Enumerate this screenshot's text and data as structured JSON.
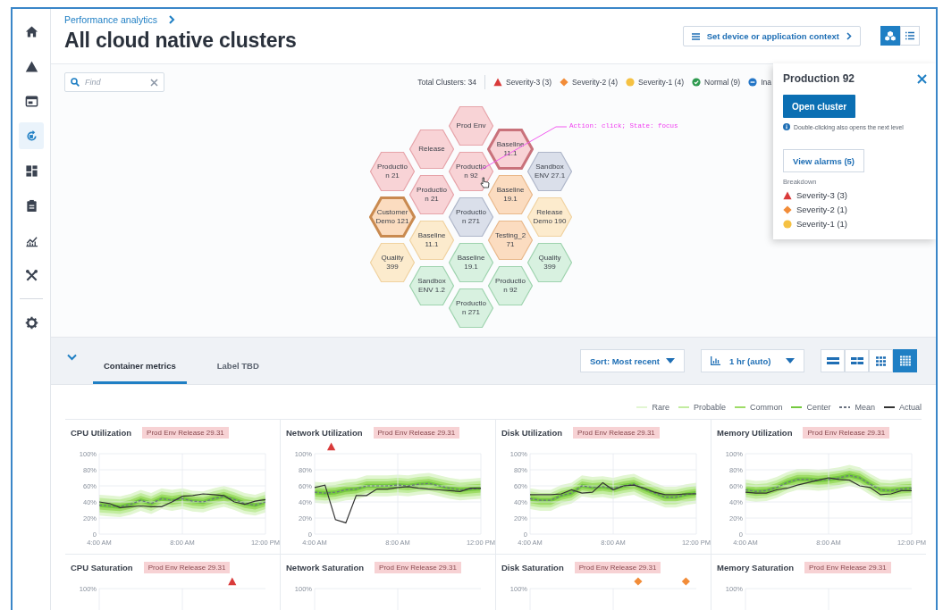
{
  "sidebar": {
    "items": [
      {
        "kind": "home",
        "selected": false
      },
      {
        "kind": "warning",
        "selected": false
      },
      {
        "kind": "window",
        "selected": false
      },
      {
        "kind": "cycle",
        "selected": true
      },
      {
        "kind": "dashboard",
        "selected": false
      },
      {
        "kind": "clipboard",
        "selected": false
      },
      {
        "kind": "chart",
        "selected": false
      },
      {
        "kind": "tools",
        "selected": false
      },
      {
        "kind": "settings",
        "selected": false
      }
    ]
  },
  "header": {
    "breadcrumb": "Performance analytics",
    "title": "All cloud native clusters",
    "context_button": "Set device or application context",
    "views": [
      {
        "kind": "hex",
        "selected": true
      },
      {
        "kind": "list",
        "selected": false
      }
    ]
  },
  "map": {
    "find": {
      "placeholder": "Find"
    },
    "total": "Total Clusters: 34",
    "legend": [
      {
        "kind": "sev3",
        "label": "Severity-3 (3)"
      },
      {
        "kind": "sev2",
        "label": "Severity-2 (4)"
      },
      {
        "kind": "sev1",
        "label": "Severity-1 (4)"
      },
      {
        "kind": "normal",
        "label": "Normal (9)"
      },
      {
        "kind": "inactive",
        "label": "Ina"
      }
    ],
    "annotation": "Action: click; State: focus",
    "columns": [
      [
        {
          "lines": [
            "Productio",
            "n 21"
          ],
          "kind": "sev3",
          "emphasized": false,
          "pointer": false
        },
        {
          "lines": [
            "Customer",
            "Demo 121"
          ],
          "kind": "sev2",
          "emphasized": true,
          "pointer": false
        },
        {
          "lines": [
            "Quality",
            "399"
          ],
          "kind": "sev1",
          "emphasized": false,
          "pointer": false
        }
      ],
      [
        {
          "lines": [
            "Release"
          ],
          "kind": "sev3",
          "emphasized": false,
          "pointer": false
        },
        {
          "lines": [
            "Productio",
            "n 21"
          ],
          "kind": "sev3",
          "emphasized": false,
          "pointer": false
        },
        {
          "lines": [
            "Baseline",
            "11.1"
          ],
          "kind": "sev1",
          "emphasized": false,
          "pointer": false
        },
        {
          "lines": [
            "Sandbox",
            "ENV 1.2"
          ],
          "kind": "normal",
          "emphasized": false,
          "pointer": false
        }
      ],
      [
        {
          "lines": [
            "Prod Env"
          ],
          "kind": "sev3",
          "emphasized": false,
          "pointer": false
        },
        {
          "lines": [
            "Productio",
            "n 92"
          ],
          "kind": "sev3",
          "emphasized": false,
          "pointer": true
        },
        {
          "lines": [
            "Productio",
            "n 271"
          ],
          "kind": "inactive",
          "emphasized": false,
          "pointer": false
        },
        {
          "lines": [
            "Baseline",
            "19.1"
          ],
          "kind": "normal",
          "emphasized": false,
          "pointer": false
        },
        {
          "lines": [
            "Productio",
            "n 271"
          ],
          "kind": "normal",
          "emphasized": false,
          "pointer": false
        }
      ],
      [
        {
          "lines": [
            "Baseline",
            "11.1"
          ],
          "kind": "sev3",
          "emphasized": true,
          "pointer": false
        },
        {
          "lines": [
            "Baseline",
            "19.1"
          ],
          "kind": "sev2",
          "emphasized": false,
          "pointer": false
        },
        {
          "lines": [
            "Testing_2",
            "71"
          ],
          "kind": "sev2",
          "emphasized": false,
          "pointer": false
        },
        {
          "lines": [
            "Productio",
            "n 92"
          ],
          "kind": "normal",
          "emphasized": false,
          "pointer": false
        }
      ],
      [
        {
          "lines": [
            "Sandbox",
            "ENV 27.1"
          ],
          "kind": "inactive",
          "emphasized": false,
          "pointer": false
        },
        {
          "lines": [
            "Release",
            "Demo 190"
          ],
          "kind": "sev1",
          "emphasized": false,
          "pointer": false
        },
        {
          "lines": [
            "Quality",
            "399"
          ],
          "kind": "normal",
          "emphasized": false,
          "pointer": false
        }
      ]
    ],
    "detail_panel": {
      "title": "Production 92",
      "open_button": "Open cluster",
      "hint": "Double-clicking also opens the next level",
      "alarms_button": "View alarms (5)",
      "breakdown_label": "Breakdown",
      "breakdown": [
        {
          "kind": "sev3",
          "label": "Severity-3 (3)"
        },
        {
          "kind": "sev2",
          "label": "Severity-2 (1)"
        },
        {
          "kind": "sev1",
          "label": "Severity-1 (1)"
        }
      ]
    }
  },
  "metrics": {
    "tabs": [
      {
        "label": "Container metrics",
        "selected": true
      },
      {
        "label": "Label TBD",
        "selected": false
      }
    ],
    "sort": "Sort: Most recent",
    "range": "1 hr (auto)",
    "layouts": [
      {
        "kind": "one",
        "selected": false
      },
      {
        "kind": "two",
        "selected": false
      },
      {
        "kind": "three",
        "selected": false
      },
      {
        "kind": "four",
        "selected": true
      }
    ],
    "legend": [
      {
        "kind": "band",
        "label": "Rare",
        "color": "#e2f6d2"
      },
      {
        "kind": "band",
        "label": "Probable",
        "color": "#c2eca0"
      },
      {
        "kind": "band",
        "label": "Common",
        "color": "#9edc66"
      },
      {
        "kind": "band",
        "label": "Center",
        "color": "#74c93e"
      },
      {
        "kind": "dashed",
        "label": "Mean",
        "color": "#6b7280"
      },
      {
        "kind": "solid",
        "label": "Actual",
        "color": "#333333"
      }
    ],
    "cards": [
      {
        "title": "CPU Utilization",
        "badge": "Prod Env Release 29.31",
        "chart_data": {
          "type": "line",
          "grid": true,
          "x": [
            4,
            4.5,
            5,
            5.5,
            6,
            6.5,
            7,
            7.5,
            8,
            8.5,
            9,
            9.5,
            10,
            10.5,
            11,
            11.5,
            12
          ],
          "series": [
            {
              "color": "#6b7280",
              "line_style": "dashed",
              "values": [
                36,
                35,
                34,
                37,
                42,
                38,
                44,
                42,
                44,
                41,
                40,
                44,
                47,
                43,
                38,
                36,
                40
              ]
            },
            {
              "color": "#333333",
              "line_style": "solid",
              "values": [
                40,
                38,
                33,
                34,
                35,
                34,
                34,
                40,
                47,
                48,
                50,
                49,
                48,
                40,
                37,
                41,
                43
              ]
            }
          ],
          "xlim": [
            4,
            12
          ],
          "ylim": [
            0,
            100
          ],
          "xticks": [
            {
              "value": 4,
              "label": "4:00 AM"
            },
            {
              "value": 8,
              "label": "8:00 AM"
            },
            {
              "value": 12,
              "label": "12:00 PM"
            }
          ],
          "yticks": [
            {
              "value": 0,
              "label": "0"
            },
            {
              "value": 20,
              "label": "20%"
            },
            {
              "value": 40,
              "label": "40%"
            },
            {
              "value": 60,
              "label": "60%"
            },
            {
              "value": 80,
              "label": "80%"
            },
            {
              "value": 100,
              "label": "100%"
            }
          ]
        }
      },
      {
        "title": "Network Utilization",
        "badge": "Prod Env Release 29.31",
        "alarms": [
          {
            "kind": "sev3"
          }
        ],
        "chart_data": {
          "type": "line",
          "grid": true,
          "x": [
            4,
            4.5,
            5,
            5.5,
            6,
            6.5,
            7,
            7.5,
            8,
            8.5,
            9,
            9.5,
            10,
            10.5,
            11,
            11.5,
            12
          ],
          "series": [
            {
              "color": "#6b7280",
              "line_style": "dashed",
              "values": [
                52,
                51,
                52,
                55,
                56,
                60,
                60,
                60,
                61,
                60,
                62,
                63,
                60,
                57,
                55,
                56,
                57
              ]
            },
            {
              "color": "#333333",
              "line_style": "solid",
              "values": [
                58,
                61,
                18,
                14,
                48,
                48,
                56,
                56,
                58,
                59,
                57,
                56,
                55,
                54,
                53,
                57,
                57
              ]
            }
          ],
          "xlim": [
            4,
            12
          ],
          "ylim": [
            0,
            100
          ],
          "xticks": [
            {
              "value": 4,
              "label": "4:00 AM"
            },
            {
              "value": 8,
              "label": "8:00 AM"
            },
            {
              "value": 12,
              "label": "12:00 PM"
            }
          ],
          "yticks": [
            {
              "value": 0,
              "label": "0"
            },
            {
              "value": 20,
              "label": "20%"
            },
            {
              "value": 40,
              "label": "40%"
            },
            {
              "value": 60,
              "label": "60%"
            },
            {
              "value": 80,
              "label": "80%"
            },
            {
              "value": 100,
              "label": "100%"
            }
          ]
        }
      },
      {
        "title": "Disk Utilization",
        "badge": "Prod Env Release 29.31",
        "chart_data": {
          "type": "line",
          "grid": true,
          "x": [
            4,
            4.5,
            5,
            5.5,
            6,
            6.5,
            7,
            7.5,
            8,
            8.5,
            9,
            9.5,
            10,
            10.5,
            11,
            11.5,
            12
          ],
          "series": [
            {
              "color": "#6b7280",
              "line_style": "dashed",
              "values": [
                44,
                42,
                42,
                48,
                51,
                60,
                58,
                59,
                57,
                60,
                62,
                56,
                51,
                46,
                46,
                49,
                51
              ]
            },
            {
              "color": "#333333",
              "line_style": "solid",
              "values": [
                49,
                49,
                49,
                50,
                55,
                51,
                52,
                64,
                55,
                60,
                61,
                57,
                52,
                49,
                49,
                50,
                50
              ]
            }
          ],
          "xlim": [
            4,
            12
          ],
          "ylim": [
            0,
            100
          ],
          "xticks": [
            {
              "value": 4,
              "label": "4:00 AM"
            },
            {
              "value": 8,
              "label": "8:00 AM"
            },
            {
              "value": 12,
              "label": "12:00 PM"
            }
          ],
          "yticks": [
            {
              "value": 0,
              "label": "0"
            },
            {
              "value": 20,
              "label": "20%"
            },
            {
              "value": 40,
              "label": "40%"
            },
            {
              "value": 60,
              "label": "60%"
            },
            {
              "value": 80,
              "label": "80%"
            },
            {
              "value": 100,
              "label": "100%"
            }
          ]
        }
      },
      {
        "title": "Memory Utilization",
        "badge": "Prod Env Release 29.31",
        "chart_data": {
          "type": "line",
          "grid": true,
          "x": [
            4,
            4.5,
            5,
            5.5,
            6,
            6.5,
            7,
            7.5,
            8,
            8.5,
            9,
            9.5,
            10,
            10.5,
            11,
            11.5,
            12
          ],
          "series": [
            {
              "color": "#6b7280",
              "line_style": "dashed",
              "values": [
                55,
                53,
                54,
                58,
                64,
                68,
                68,
                67,
                68,
                70,
                73,
                70,
                62,
                55,
                54,
                56,
                57
              ]
            },
            {
              "color": "#333333",
              "line_style": "solid",
              "values": [
                52,
                51,
                51,
                55,
                57,
                61,
                64,
                67,
                70,
                68,
                67,
                60,
                58,
                49,
                50,
                54,
                54
              ]
            }
          ],
          "xlim": [
            4,
            12
          ],
          "ylim": [
            0,
            100
          ],
          "xticks": [
            {
              "value": 4,
              "label": "4:00 AM"
            },
            {
              "value": 8,
              "label": "8:00 AM"
            },
            {
              "value": 12,
              "label": "12:00 PM"
            }
          ],
          "yticks": [
            {
              "value": 0,
              "label": "0"
            },
            {
              "value": 20,
              "label": "20%"
            },
            {
              "value": 40,
              "label": "40%"
            },
            {
              "value": 60,
              "label": "60%"
            },
            {
              "value": 80,
              "label": "80%"
            },
            {
              "value": 100,
              "label": "100%"
            }
          ]
        }
      },
      {
        "title": "CPU Saturation",
        "badge": "Prod Env Release 29.31",
        "alarms": [
          {
            "kind": "sev3"
          }
        ],
        "axis_label": "100%"
      },
      {
        "title": "Network Saturation",
        "badge": "Prod Env Release 29.31",
        "axis_label": "100%"
      },
      {
        "title": "Disk Saturation",
        "badge": "Prod Env Release 29.31",
        "alarms": [
          {
            "kind": "sev2"
          },
          {
            "kind": "sev2"
          }
        ],
        "axis_label": "100%"
      },
      {
        "title": "Memory Saturation",
        "badge": "Prod Env Release 29.31",
        "axis_label": "100%"
      }
    ]
  }
}
